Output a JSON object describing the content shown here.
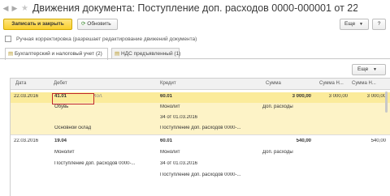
{
  "window": {
    "back_icon": "arrow-left-icon",
    "forward_icon": "arrow-right-icon",
    "favorite_icon": "star-icon",
    "title": "Движения документа: Поступление доп. расходов 0000-000001 от 22.03.2016 1..."
  },
  "toolbar": {
    "save_close_label": "Записать и закрыть",
    "refresh_label": "Обновить",
    "more_label": "Еще",
    "help_label": "?"
  },
  "manual_adjust": {
    "label": "Ручная корректировка (разрешает редактирование движений документа)",
    "checked": false
  },
  "tabs": [
    {
      "label": "Бухгалтерский и налоговый учет (2)",
      "active": true
    },
    {
      "label": "НДС предъявленный (1)",
      "active": false
    }
  ],
  "table_toolbar": {
    "more_label": "Еще"
  },
  "columns": {
    "date": "Дата",
    "debit": "Дебет",
    "credit": "Кредит",
    "amount": "Сумма",
    "amount_n1": "Сумма Н...",
    "amount_n2": "Сумма Н..."
  },
  "rows": [
    {
      "date": "22.03.2016",
      "debit_account": "41.01",
      "debit_hint": "Кол.",
      "credit_account": "60.01",
      "amount": "3 000,00",
      "amount_n1": "3 000,00",
      "amount_n2": "3 000,00",
      "debit_sub1": "Обувь",
      "credit_sub1": "Монолит",
      "amount_sub1": "Доп. расходы",
      "credit_sub2": "34 от 01.03.2016",
      "debit_sub3": "Основной склад",
      "credit_sub3": "Поступление доп. расходов 0000-..."
    },
    {
      "date": "22.03.2016",
      "debit_account": "19.04",
      "credit_account": "60.01",
      "amount": "540,00",
      "amount_n2": "540,00",
      "debit_sub1": "Монолит",
      "credit_sub1": "Монолит",
      "amount_sub1": "Доп. расходы",
      "debit_sub2": "Поступление доп. расходов 0000-...",
      "credit_sub2": "34 от 01.03.2016",
      "credit_sub3": "Поступление доп. расходов 0000-..."
    }
  ]
}
